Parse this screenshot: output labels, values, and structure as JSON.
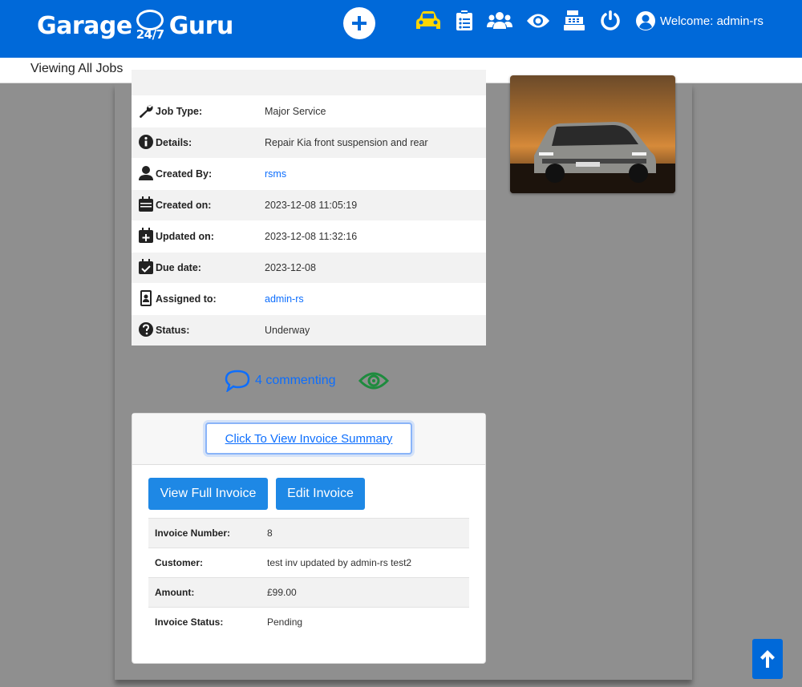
{
  "brand": {
    "left": "Garage",
    "badge": "24/7",
    "right": "Guru"
  },
  "header": {
    "welcome": "Welcome: admin-rs",
    "nav_icons": [
      "car-icon",
      "clipboard-list-icon",
      "users-icon",
      "eye-icon",
      "cash-register-icon",
      "power-icon"
    ]
  },
  "subbar": {
    "title": "Viewing All Jobs"
  },
  "job": {
    "rows": [
      {
        "label": "Job Type:",
        "value": "Major Service",
        "icon": "wrench-icon"
      },
      {
        "label": "Details:",
        "value": "Repair Kia front suspension and rear",
        "icon": "info-icon"
      },
      {
        "label": "Created By:",
        "value": "rsms",
        "icon": "user-icon"
      },
      {
        "label": "Created on:",
        "value": "2023-12-08 11:05:19",
        "icon": "calendar-icon"
      },
      {
        "label": "Updated on:",
        "value": "2023-12-08 11:32:16",
        "icon": "calendar-plus-icon"
      },
      {
        "label": "Due date:",
        "value": "2023-12-08",
        "icon": "calendar-check-icon"
      },
      {
        "label": "Assigned to:",
        "value": "admin-rs",
        "icon": "id-badge-icon"
      },
      {
        "label": "Status:",
        "value": "Underway",
        "icon": "question-icon"
      }
    ]
  },
  "comments": {
    "count_label": "4 commenting"
  },
  "invoice": {
    "summary_label": "Click To View Invoice Summary",
    "view_full_label": "View Full Invoice",
    "edit_label": "Edit Invoice",
    "rows": [
      {
        "key": "Invoice Number:",
        "value": "8"
      },
      {
        "key": "Customer:",
        "value": "test inv updated by admin-rs test2"
      },
      {
        "key": "Amount:",
        "value": "£99.00"
      },
      {
        "key": "Invoice Status:",
        "value": "Pending"
      }
    ]
  },
  "colors": {
    "primary": "#0069d9",
    "accent": "#ffd600",
    "link": "#0d6efd",
    "background": "#8f8f8f"
  }
}
